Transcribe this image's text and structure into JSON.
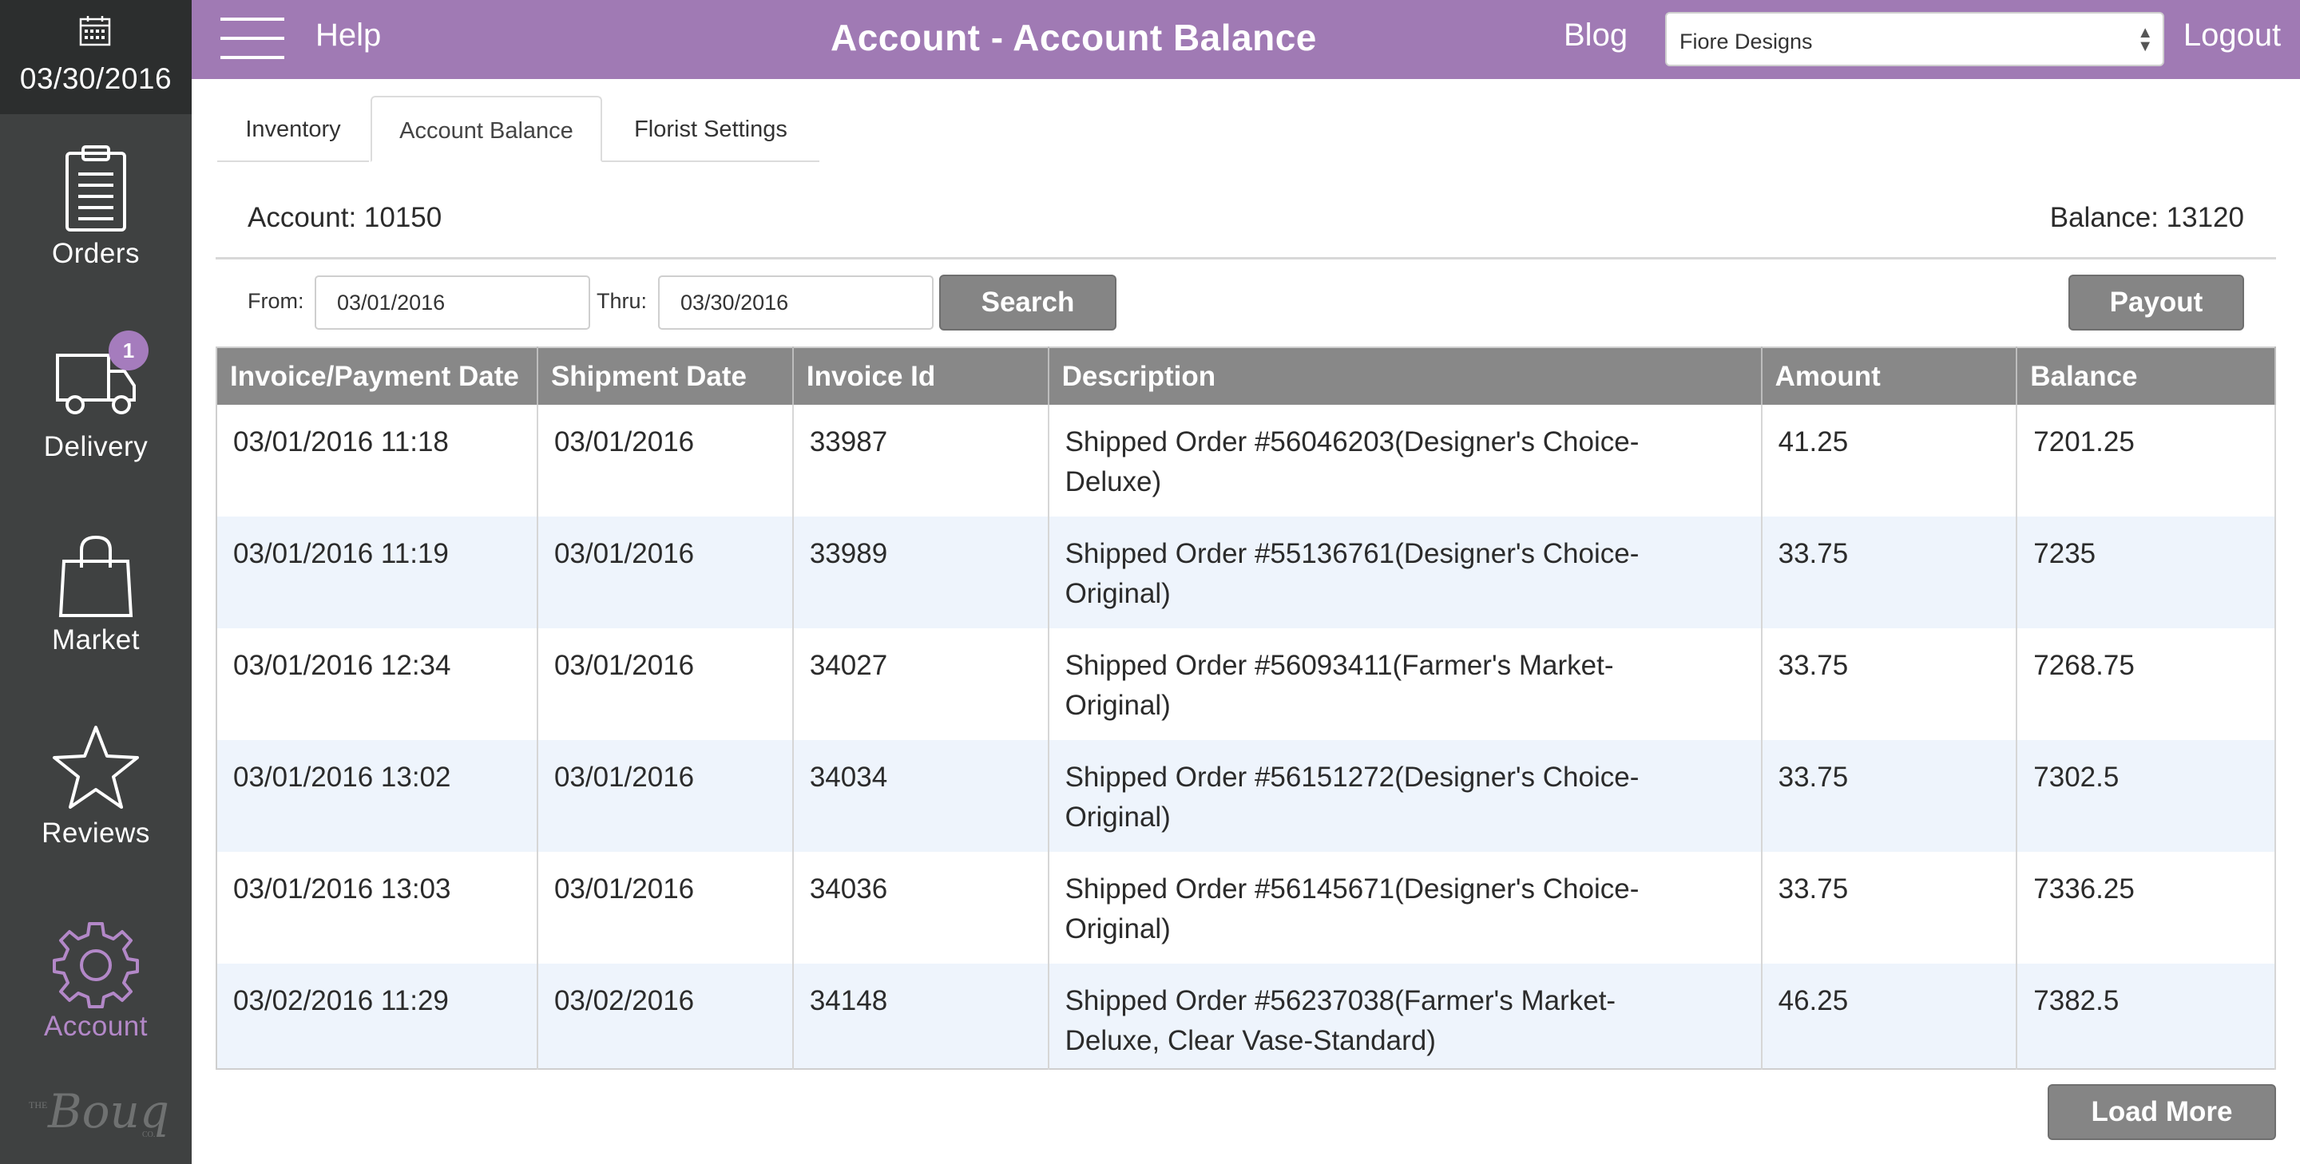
{
  "sidebar": {
    "date": "03/30/2016",
    "items": [
      {
        "label": "Orders",
        "icon": "clipboard-icon"
      },
      {
        "label": "Delivery",
        "icon": "truck-icon",
        "badge": "1"
      },
      {
        "label": "Market",
        "icon": "shopping-bag-icon"
      },
      {
        "label": "Reviews",
        "icon": "star-icon"
      },
      {
        "label": "Account",
        "icon": "gear-icon",
        "active": true
      }
    ],
    "brand": "Bouqs"
  },
  "topbar": {
    "help": "Help",
    "title": "Account - Account Balance",
    "blog": "Blog",
    "store_selected": "Fiore Designs",
    "logout": "Logout"
  },
  "tabs": [
    "Inventory",
    "Account Balance",
    "Florist Settings"
  ],
  "active_tab": "Account Balance",
  "summary": {
    "account": "Account: 10150",
    "balance": "Balance: 13120"
  },
  "filters": {
    "from_label": "From:",
    "from_value": "03/01/2016",
    "thru_label": "Thru:",
    "thru_value": "03/30/2016",
    "search_label": "Search",
    "payout_label": "Payout"
  },
  "table": {
    "columns": [
      "Invoice/Payment Date",
      "Shipment Date",
      "Invoice Id",
      "Description",
      "Amount",
      "Balance"
    ],
    "rows": [
      [
        "03/01/2016 11:18",
        "03/01/2016",
        "33987",
        "Shipped Order #56046203(Designer's Choice-",
        "Deluxe)",
        "41.25",
        "7201.25"
      ],
      [
        "03/01/2016 11:19",
        "03/01/2016",
        "33989",
        "Shipped Order #55136761(Designer's Choice-",
        "Original)",
        "33.75",
        "7235"
      ],
      [
        "03/01/2016 12:34",
        "03/01/2016",
        "34027",
        "Shipped Order #56093411(Farmer's Market-",
        "Original)",
        "33.75",
        "7268.75"
      ],
      [
        "03/01/2016 13:02",
        "03/01/2016",
        "34034",
        "Shipped Order #56151272(Designer's Choice-",
        "Original)",
        "33.75",
        "7302.5"
      ],
      [
        "03/01/2016 13:03",
        "03/01/2016",
        "34036",
        "Shipped Order #56145671(Designer's Choice-",
        "Original)",
        "33.75",
        "7336.25"
      ],
      [
        "03/02/2016 11:29",
        "03/02/2016",
        "34148",
        "Shipped Order #56237038(Farmer's Market-",
        "Deluxe, Clear Vase-Standard)",
        "46.25",
        "7382.5"
      ]
    ]
  },
  "load_more_label": "Load More",
  "colors": {
    "topbar": "#a07ab4",
    "sidebar": "#3f4141",
    "active_nav": "#b388c8",
    "header_row": "#888888",
    "alt_row": "#eef4fc"
  }
}
